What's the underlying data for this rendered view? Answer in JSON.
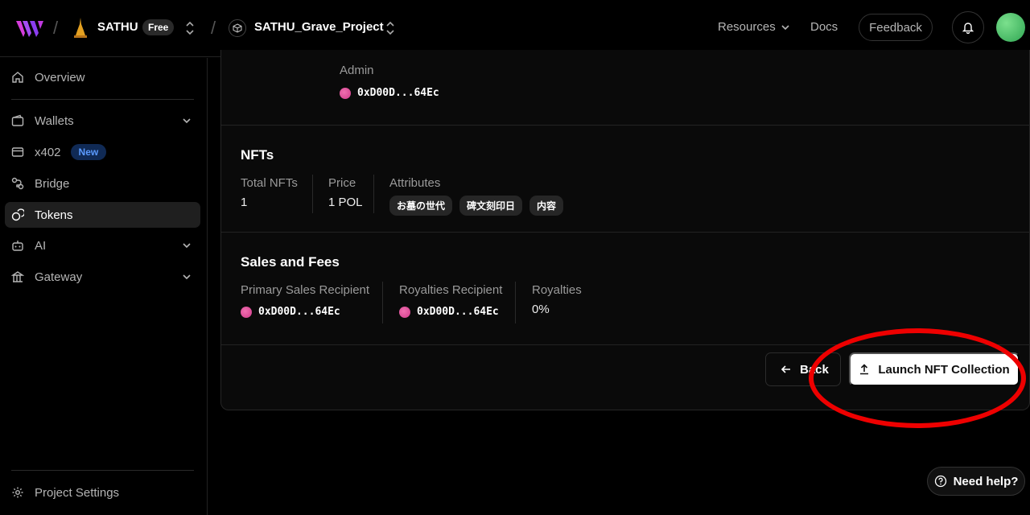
{
  "topbar": {
    "team_name": "SATHU",
    "plan_badge": "Free",
    "project_name": "SATHU_Grave_Project",
    "resources_label": "Resources",
    "docs_label": "Docs",
    "feedback_label": "Feedback",
    "separator": "/"
  },
  "sidebar": {
    "items": [
      {
        "label": "Overview",
        "icon": "home-icon"
      },
      {
        "label": "Wallets",
        "icon": "wallet-icon"
      },
      {
        "label": "x402",
        "icon": "card-icon",
        "badge": "New"
      },
      {
        "label": "Bridge",
        "icon": "bridge-icon"
      },
      {
        "label": "Tokens",
        "icon": "token-icon",
        "active": true
      },
      {
        "label": "AI",
        "icon": "robot-icon"
      },
      {
        "label": "Gateway",
        "icon": "gateway-icon"
      }
    ],
    "settings_label": "Project Settings"
  },
  "main": {
    "admin": {
      "label": "Admin",
      "address": "0xD00D...64Ec"
    },
    "nfts": {
      "title": "NFTs",
      "total_label": "Total NFTs",
      "total_value": "1",
      "price_label": "Price",
      "price_value": "1 POL",
      "attributes_label": "Attributes",
      "attributes": [
        "お墓の世代",
        "碑文刻印日",
        "内容"
      ]
    },
    "sales": {
      "title": "Sales and Fees",
      "primary_label": "Primary Sales Recipient",
      "primary_address": "0xD00D...64Ec",
      "royalty_recipient_label": "Royalties Recipient",
      "royalty_recipient_address": "0xD00D...64Ec",
      "royalties_label": "Royalties",
      "royalties_value": "0%"
    },
    "back_label": "Back",
    "launch_label": "Launch NFT Collection"
  },
  "help_label": "Need help?",
  "colors": {
    "accent_pink": "#e0559e",
    "highlight_red": "#ee0000",
    "new_badge_text": "#5b9bff"
  }
}
